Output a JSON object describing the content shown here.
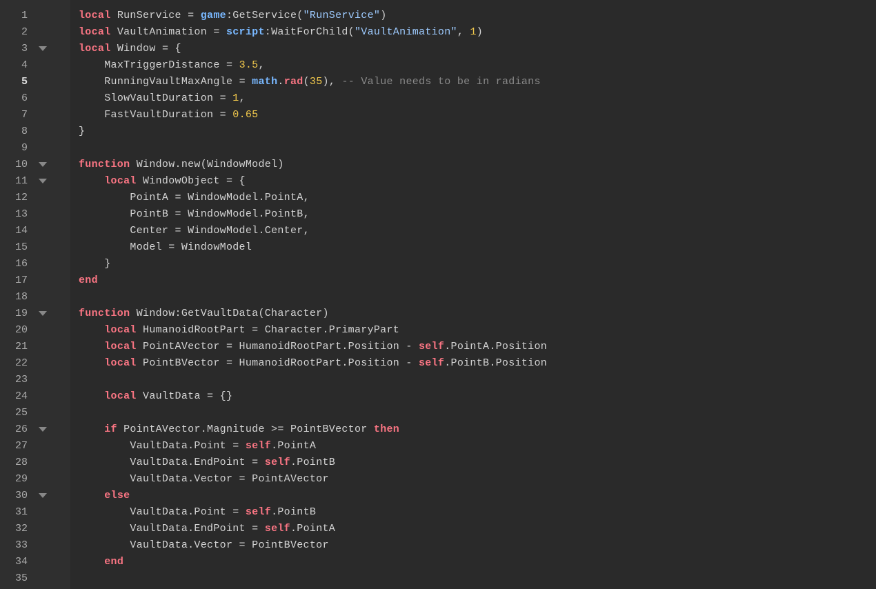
{
  "editor": {
    "current_line": 5,
    "lines": [
      {
        "n": 1,
        "fold": false,
        "tokens": [
          {
            "t": "local ",
            "c": "keyword"
          },
          {
            "t": "RunService ",
            "c": "ident"
          },
          {
            "t": "= ",
            "c": "punct"
          },
          {
            "t": "game",
            "c": "builtin"
          },
          {
            "t": ":GetService(",
            "c": "punct"
          },
          {
            "t": "\"RunService\"",
            "c": "string"
          },
          {
            "t": ")",
            "c": "punct"
          }
        ]
      },
      {
        "n": 2,
        "fold": false,
        "tokens": [
          {
            "t": "local ",
            "c": "keyword"
          },
          {
            "t": "VaultAnimation ",
            "c": "ident"
          },
          {
            "t": "= ",
            "c": "punct"
          },
          {
            "t": "script",
            "c": "builtin"
          },
          {
            "t": ":WaitForChild(",
            "c": "punct"
          },
          {
            "t": "\"VaultAnimation\"",
            "c": "string"
          },
          {
            "t": ", ",
            "c": "punct"
          },
          {
            "t": "1",
            "c": "number"
          },
          {
            "t": ")",
            "c": "punct"
          }
        ]
      },
      {
        "n": 3,
        "fold": true,
        "tokens": [
          {
            "t": "local ",
            "c": "keyword"
          },
          {
            "t": "Window ",
            "c": "ident"
          },
          {
            "t": "= {",
            "c": "punct"
          }
        ]
      },
      {
        "n": 4,
        "fold": false,
        "indent": 1,
        "tokens": [
          {
            "t": "MaxTriggerDistance ",
            "c": "ident"
          },
          {
            "t": "= ",
            "c": "punct"
          },
          {
            "t": "3.5",
            "c": "number"
          },
          {
            "t": ",",
            "c": "punct"
          }
        ]
      },
      {
        "n": 5,
        "fold": false,
        "indent": 1,
        "tokens": [
          {
            "t": "RunningVaultMaxAngle ",
            "c": "ident"
          },
          {
            "t": "= ",
            "c": "punct"
          },
          {
            "t": "math",
            "c": "builtin"
          },
          {
            "t": ".",
            "c": "punct"
          },
          {
            "t": "rad",
            "c": "mathrad"
          },
          {
            "t": "(",
            "c": "punct"
          },
          {
            "t": "35",
            "c": "number"
          },
          {
            "t": "), ",
            "c": "punct"
          },
          {
            "t": "-- Value needs to be in radians",
            "c": "comment"
          }
        ]
      },
      {
        "n": 6,
        "fold": false,
        "indent": 1,
        "tokens": [
          {
            "t": "SlowVaultDuration ",
            "c": "ident"
          },
          {
            "t": "= ",
            "c": "punct"
          },
          {
            "t": "1",
            "c": "number"
          },
          {
            "t": ",",
            "c": "punct"
          }
        ]
      },
      {
        "n": 7,
        "fold": false,
        "indent": 1,
        "tokens": [
          {
            "t": "FastVaultDuration ",
            "c": "ident"
          },
          {
            "t": "= ",
            "c": "punct"
          },
          {
            "t": "0.65",
            "c": "number"
          }
        ]
      },
      {
        "n": 8,
        "fold": false,
        "tokens": [
          {
            "t": "}",
            "c": "punct"
          }
        ]
      },
      {
        "n": 9,
        "fold": false,
        "tokens": []
      },
      {
        "n": 10,
        "fold": true,
        "tokens": [
          {
            "t": "function ",
            "c": "keyword"
          },
          {
            "t": "Window.new(WindowModel)",
            "c": "ident"
          }
        ]
      },
      {
        "n": 11,
        "fold": true,
        "indent": 1,
        "tokens": [
          {
            "t": "local ",
            "c": "keyword"
          },
          {
            "t": "WindowObject ",
            "c": "ident"
          },
          {
            "t": "= {",
            "c": "punct"
          }
        ]
      },
      {
        "n": 12,
        "fold": false,
        "indent": 2,
        "tokens": [
          {
            "t": "PointA ",
            "c": "ident"
          },
          {
            "t": "= WindowModel.PointA,",
            "c": "punct"
          }
        ]
      },
      {
        "n": 13,
        "fold": false,
        "indent": 2,
        "tokens": [
          {
            "t": "PointB ",
            "c": "ident"
          },
          {
            "t": "= WindowModel.PointB,",
            "c": "punct"
          }
        ]
      },
      {
        "n": 14,
        "fold": false,
        "indent": 2,
        "tokens": [
          {
            "t": "Center ",
            "c": "ident"
          },
          {
            "t": "= WindowModel.Center,",
            "c": "punct"
          }
        ]
      },
      {
        "n": 15,
        "fold": false,
        "indent": 2,
        "tokens": [
          {
            "t": "Model ",
            "c": "ident"
          },
          {
            "t": "= WindowModel",
            "c": "punct"
          }
        ]
      },
      {
        "n": 16,
        "fold": false,
        "indent": 1,
        "tokens": [
          {
            "t": "}",
            "c": "punct"
          }
        ]
      },
      {
        "n": 17,
        "fold": false,
        "tokens": [
          {
            "t": "end",
            "c": "keyword"
          }
        ]
      },
      {
        "n": 18,
        "fold": false,
        "tokens": []
      },
      {
        "n": 19,
        "fold": true,
        "tokens": [
          {
            "t": "function ",
            "c": "keyword"
          },
          {
            "t": "Window:GetVaultData(Character)",
            "c": "ident"
          }
        ]
      },
      {
        "n": 20,
        "fold": false,
        "indent": 1,
        "tokens": [
          {
            "t": "local ",
            "c": "keyword"
          },
          {
            "t": "HumanoidRootPart ",
            "c": "ident"
          },
          {
            "t": "= Character.PrimaryPart",
            "c": "punct"
          }
        ]
      },
      {
        "n": 21,
        "fold": false,
        "indent": 1,
        "tokens": [
          {
            "t": "local ",
            "c": "keyword"
          },
          {
            "t": "PointAVector ",
            "c": "ident"
          },
          {
            "t": "= HumanoidRootPart.Position - ",
            "c": "punct"
          },
          {
            "t": "self",
            "c": "self"
          },
          {
            "t": ".PointA.Position",
            "c": "punct"
          }
        ]
      },
      {
        "n": 22,
        "fold": false,
        "indent": 1,
        "tokens": [
          {
            "t": "local ",
            "c": "keyword"
          },
          {
            "t": "PointBVector ",
            "c": "ident"
          },
          {
            "t": "= HumanoidRootPart.Position - ",
            "c": "punct"
          },
          {
            "t": "self",
            "c": "self"
          },
          {
            "t": ".PointB.Position",
            "c": "punct"
          }
        ]
      },
      {
        "n": 23,
        "fold": false,
        "tokens": []
      },
      {
        "n": 24,
        "fold": false,
        "indent": 1,
        "tokens": [
          {
            "t": "local ",
            "c": "keyword"
          },
          {
            "t": "VaultData ",
            "c": "ident"
          },
          {
            "t": "= {}",
            "c": "punct"
          }
        ]
      },
      {
        "n": 25,
        "fold": false,
        "tokens": []
      },
      {
        "n": 26,
        "fold": true,
        "indent": 1,
        "tokens": [
          {
            "t": "if ",
            "c": "keyword"
          },
          {
            "t": "PointAVector.Magnitude >= PointBVector ",
            "c": "ident"
          },
          {
            "t": "then",
            "c": "keyword"
          }
        ]
      },
      {
        "n": 27,
        "fold": false,
        "indent": 2,
        "tokens": [
          {
            "t": "VaultData.Point = ",
            "c": "ident"
          },
          {
            "t": "self",
            "c": "self"
          },
          {
            "t": ".PointA",
            "c": "punct"
          }
        ]
      },
      {
        "n": 28,
        "fold": false,
        "indent": 2,
        "tokens": [
          {
            "t": "VaultData.EndPoint = ",
            "c": "ident"
          },
          {
            "t": "self",
            "c": "self"
          },
          {
            "t": ".PointB",
            "c": "punct"
          }
        ]
      },
      {
        "n": 29,
        "fold": false,
        "indent": 2,
        "tokens": [
          {
            "t": "VaultData.Vector = PointAVector",
            "c": "ident"
          }
        ]
      },
      {
        "n": 30,
        "fold": true,
        "indent": 1,
        "tokens": [
          {
            "t": "else",
            "c": "keyword"
          }
        ]
      },
      {
        "n": 31,
        "fold": false,
        "indent": 2,
        "tokens": [
          {
            "t": "VaultData.Point = ",
            "c": "ident"
          },
          {
            "t": "self",
            "c": "self"
          },
          {
            "t": ".PointB",
            "c": "punct"
          }
        ]
      },
      {
        "n": 32,
        "fold": false,
        "indent": 2,
        "tokens": [
          {
            "t": "VaultData.EndPoint = ",
            "c": "ident"
          },
          {
            "t": "self",
            "c": "self"
          },
          {
            "t": ".PointA",
            "c": "punct"
          }
        ]
      },
      {
        "n": 33,
        "fold": false,
        "indent": 2,
        "tokens": [
          {
            "t": "VaultData.Vector = PointBVector",
            "c": "ident"
          }
        ]
      },
      {
        "n": 34,
        "fold": false,
        "indent": 1,
        "tokens": [
          {
            "t": "end",
            "c": "keyword"
          }
        ]
      },
      {
        "n": 35,
        "fold": false,
        "tokens": []
      }
    ]
  }
}
